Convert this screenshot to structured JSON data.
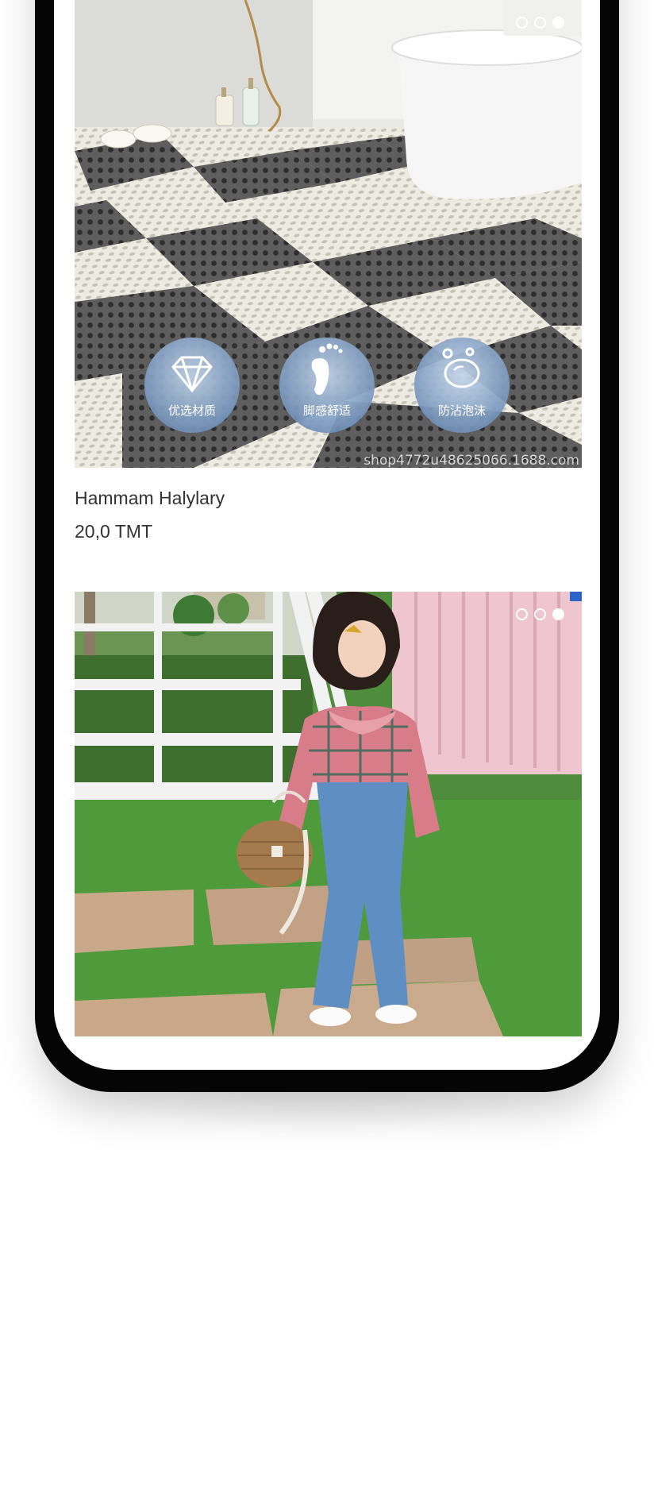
{
  "products": [
    {
      "title": "Hammam Halylary",
      "price": "20,0 TMT",
      "image_icons": [
        "diamond-icon",
        "footprint-icon",
        "bubble-icon"
      ],
      "image_badges": [
        "优选材质",
        "脚感舒适",
        "防沾泡沫"
      ],
      "image_watermark": "shop4772u48625066.1688.com",
      "carousel": {
        "total": 3,
        "active": 3
      }
    },
    {
      "title": "",
      "price": "",
      "carousel": {
        "total": 3,
        "active": 3
      }
    }
  ],
  "colors": {
    "device_frame": "#050505",
    "text": "#333333",
    "dot": "#ffffff"
  }
}
